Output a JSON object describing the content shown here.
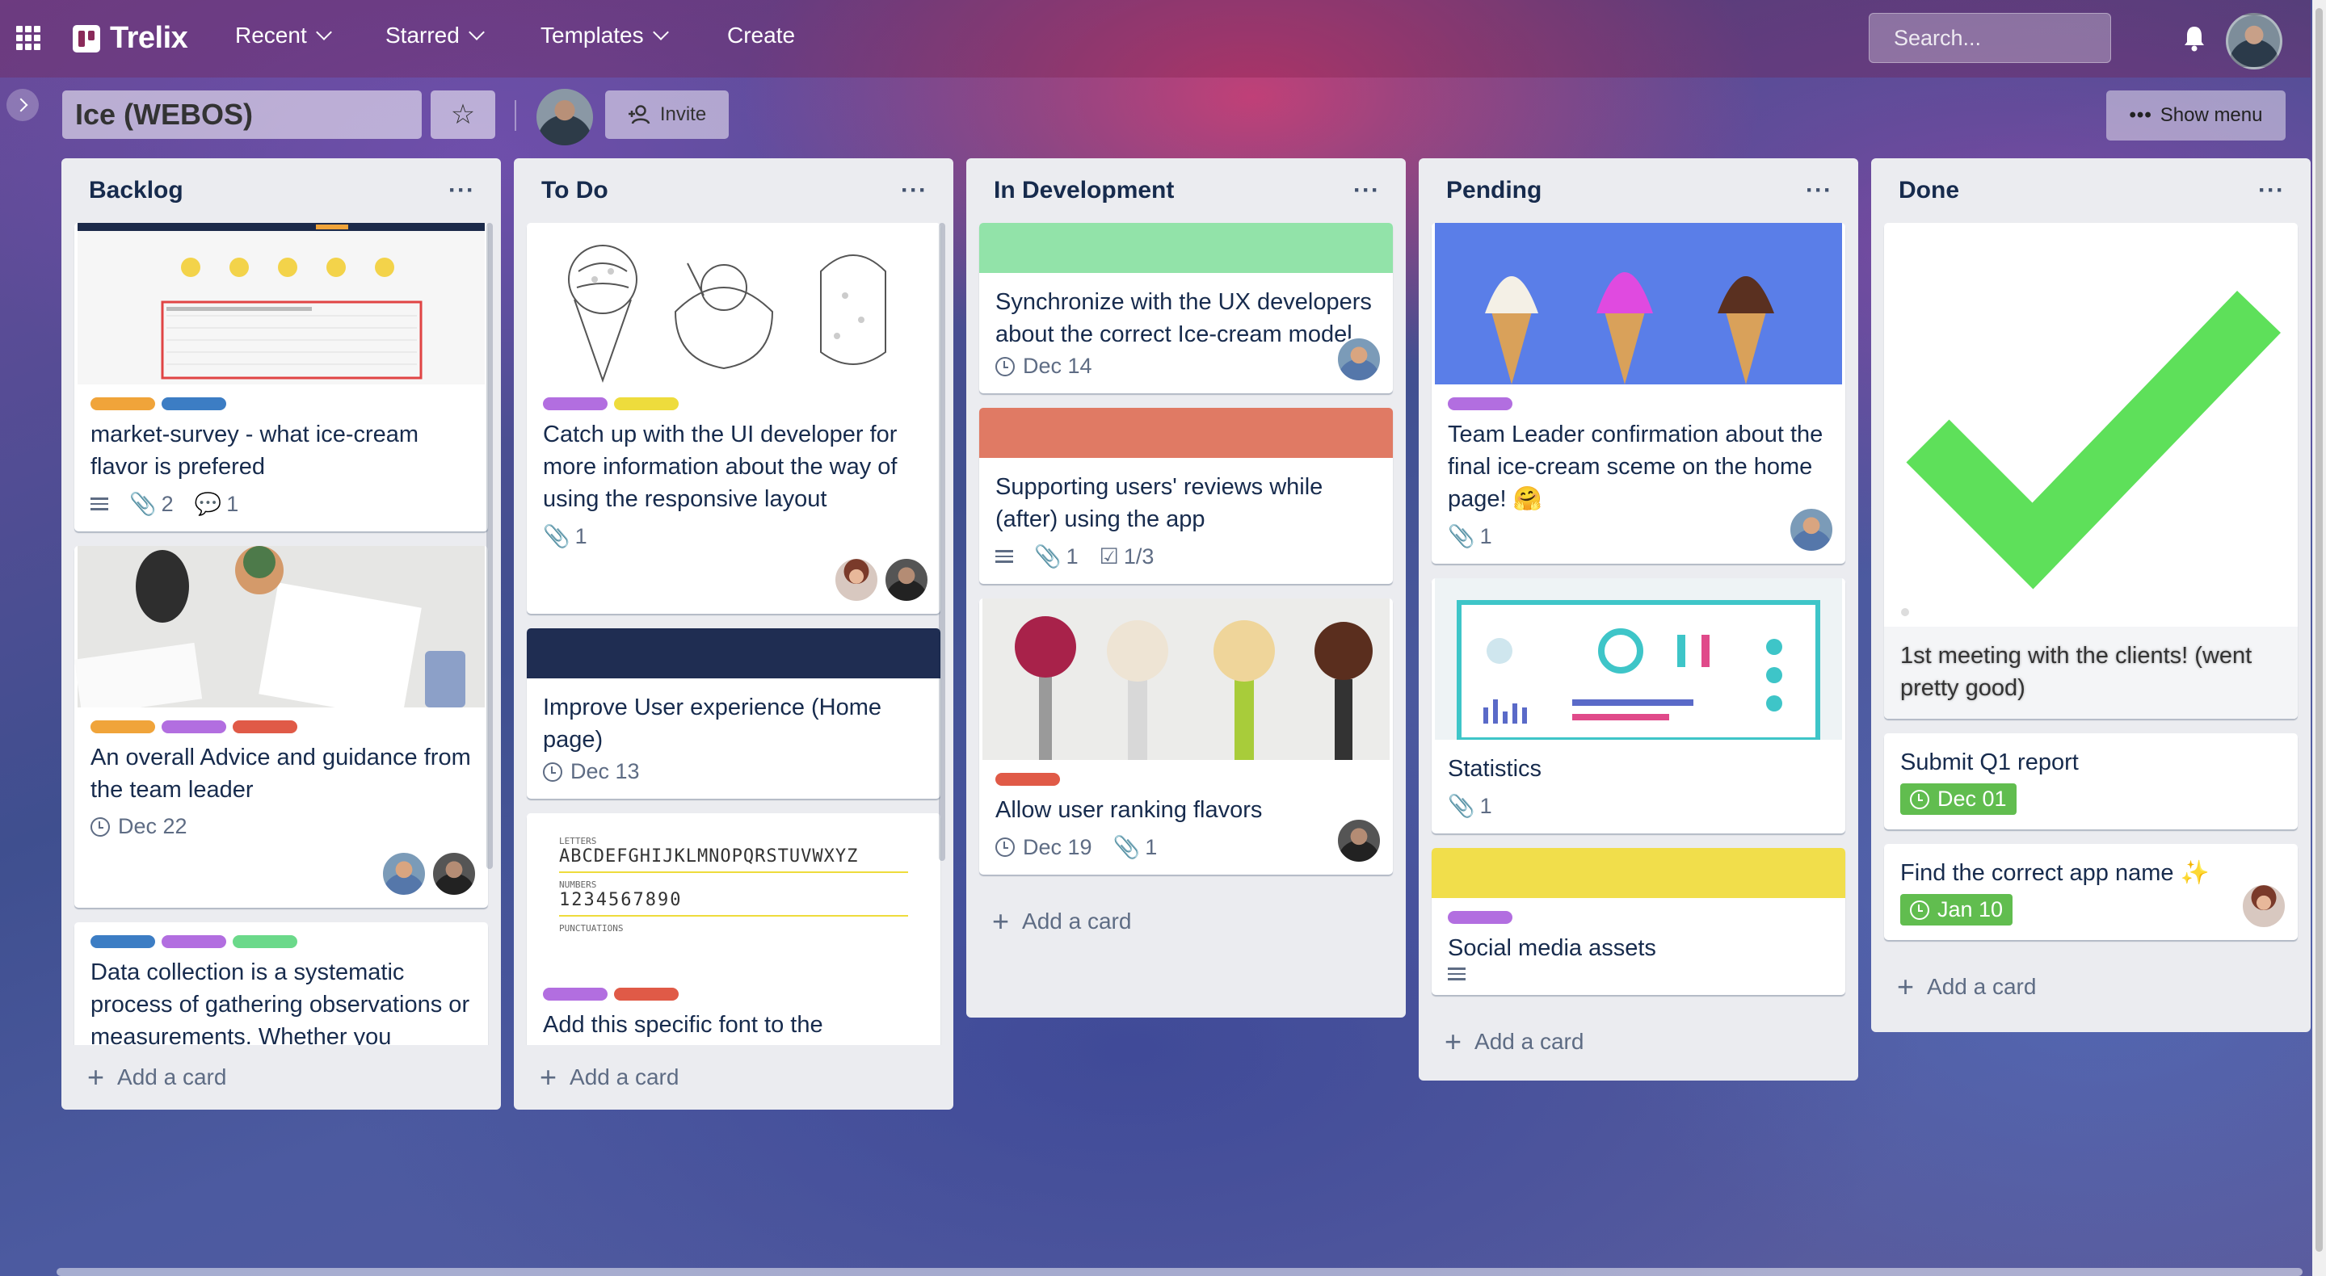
{
  "app": {
    "name": "Trelix"
  },
  "nav": {
    "recent": "Recent",
    "starred": "Starred",
    "templates": "Templates",
    "create": "Create"
  },
  "search": {
    "placeholder": "Search..."
  },
  "board": {
    "title": "Ice (WEBOS)",
    "invite_label": "Invite",
    "show_menu_label": "Show menu"
  },
  "add_card_label": "Add a card",
  "lists": [
    {
      "title": "Backlog",
      "cards": [
        {
          "title": "market-survey - what ice-cream flavor is prefered",
          "labels": [
            "#f0a43a",
            "#3c7dc4"
          ],
          "attachments": "2",
          "comments": "1",
          "has_description": true,
          "cover": "survey-screenshot"
        },
        {
          "title": "An overall Advice and guidance from the team leader",
          "labels": [
            "#f0a43a",
            "#b26ee0",
            "#e05a47"
          ],
          "due": "Dec 22",
          "cover": "desk-photo"
        },
        {
          "title": "Data collection is a systematic process of gathering observations or measurements. Whether you",
          "labels": [
            "#3c7dc4",
            "#b26ee0",
            "#6bd98a"
          ]
        }
      ]
    },
    {
      "title": "To Do",
      "cards": [
        {
          "title": "Catch up with the UI developer for more information about the way of using the responsive layout",
          "labels": [
            "#b26ee0",
            "#eedc3c"
          ],
          "attachments": "1",
          "cover": "ice-cream-sketch"
        },
        {
          "title": "Improve User experience (Home page)",
          "due": "Dec 13",
          "cover_color": "#1f2d52"
        },
        {
          "title": "Add this specific font to the",
          "labels": [
            "#b26ee0",
            "#e05a47"
          ],
          "cover": "font-specimen",
          "font_specimen": {
            "letters_label": "LETTERS",
            "letters": "ABCDEFGHIJKLMNOPQRSTUVWXYZ",
            "numbers_label": "NUMBERS",
            "numbers": "1234567890",
            "punct_label": "PUNCTUATIONS"
          }
        }
      ]
    },
    {
      "title": "In Development",
      "cards": [
        {
          "title": "Synchronize with the UX developers about the correct Ice-cream model",
          "due": "Dec 14",
          "cover_color": "#92e3a9"
        },
        {
          "title": "Supporting users' reviews while (after) using the app",
          "attachments": "1",
          "checklist": "1/3",
          "has_description": true,
          "cover_color": "#e07a64"
        },
        {
          "title": "Allow user ranking flavors",
          "labels": [
            "#e05a47"
          ],
          "due": "Dec 19",
          "attachments": "1",
          "cover": "scoops-photo"
        }
      ]
    },
    {
      "title": "Pending",
      "cards": [
        {
          "title": "Team Leader confirmation about the final ice-cream sceme on the home page! 🤗",
          "labels": [
            "#b26ee0"
          ],
          "attachments": "1",
          "cover": "cones-photo"
        },
        {
          "title": "Statistics",
          "attachments": "1",
          "cover": "dashboard-illustration"
        },
        {
          "title": "Social media assets",
          "labels": [
            "#b26ee0"
          ],
          "has_description": true,
          "cover_color": "#f1de4b"
        }
      ]
    },
    {
      "title": "Done",
      "cards": [
        {
          "title": "1st meeting with the clients! (went pretty good)",
          "cover": "green-checkmark",
          "archived_style": true
        },
        {
          "title": "Submit Q1 report",
          "due": "Dec 01",
          "due_complete": true
        },
        {
          "title": "Find the correct app name ✨",
          "due": "Jan 10",
          "due_complete": true
        }
      ]
    }
  ],
  "colors": {
    "list_bg": "#ebecf0",
    "text": "#172b4d",
    "muted": "#5e6c84",
    "due_complete": "#61bd4f"
  }
}
